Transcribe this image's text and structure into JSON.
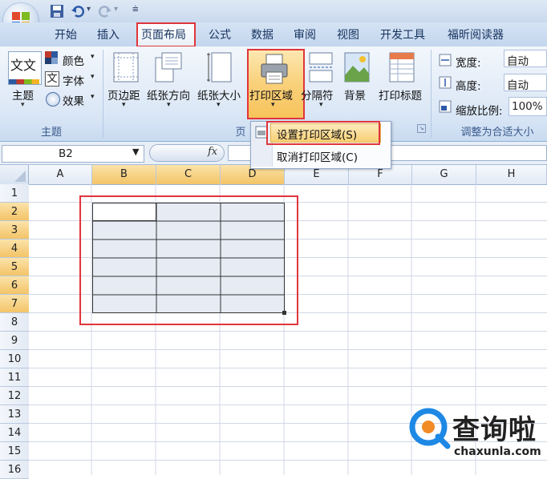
{
  "quick_access": {
    "undo_icon": "undo-icon",
    "redo_icon": "redo-icon",
    "save_icon": "save-icon"
  },
  "tabs": [
    "开始",
    "插入",
    "页面布局",
    "公式",
    "数据",
    "审阅",
    "视图",
    "开发工具",
    "福昕阅读器"
  ],
  "active_tab": "页面布局",
  "ribbon": {
    "theme_group": {
      "title": "主题",
      "theme_button": "主题",
      "theme_icon_text": "文文",
      "colors": "颜色",
      "fonts": "字体",
      "font_icon_text": "文",
      "effects": "效果"
    },
    "page_setup_group": {
      "title_visible": "页",
      "margins": "页边距",
      "orientation": "纸张方向",
      "size": "纸张大小",
      "print_area": "打印区域",
      "breaks": "分隔符",
      "background": "背景",
      "print_titles": "打印标题"
    },
    "scale_group": {
      "title": "调整为合适大小",
      "width_label": "宽度:",
      "width_value": "自动",
      "height_label": "高度:",
      "height_value": "自动",
      "scale_label": "缩放比例:",
      "scale_value": "100%"
    }
  },
  "print_area_menu": {
    "set": "设置打印区域(S)",
    "clear": "取消打印区域(C)"
  },
  "formula_bar": {
    "name_box": "B2",
    "fx": "fx"
  },
  "columns": [
    "A",
    "B",
    "C",
    "D",
    "E",
    "F",
    "G",
    "H"
  ],
  "selected_columns": [
    "B",
    "C",
    "D"
  ],
  "rows": [
    "1",
    "2",
    "3",
    "4",
    "5",
    "6",
    "7",
    "8",
    "9",
    "10",
    "11",
    "12",
    "13",
    "14",
    "15",
    "16"
  ],
  "selected_rows": [
    "2",
    "3",
    "4",
    "5",
    "6",
    "7"
  ],
  "watermark": {
    "main": "查询啦",
    "sub": "chaxunla.com"
  }
}
